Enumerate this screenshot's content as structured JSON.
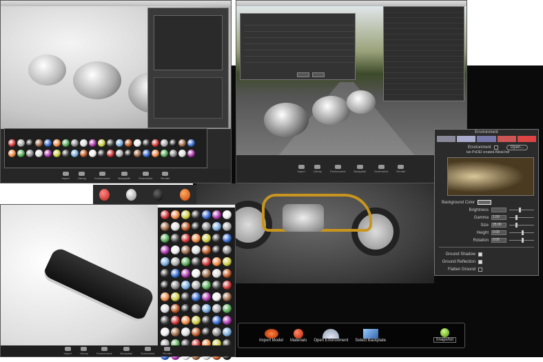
{
  "top_left_window": {
    "toolbar": [
      "Import",
      "Library",
      "Environment",
      "Backplate",
      "Screenshot",
      "Render"
    ]
  },
  "top_right_window": {
    "toolbar": [
      "Import",
      "Library",
      "Environment",
      "Backplate",
      "Screenshot",
      "Render"
    ]
  },
  "environment_panel": {
    "title": "Environment",
    "environment_label": "Environment",
    "open_button": "Open...",
    "file_name": "lan PoDEl created Alleal.hdr",
    "background_color_label": "Background Color",
    "sliders": [
      {
        "label": "Brightness",
        "value": "",
        "fraction": 0.4
      },
      {
        "label": "Gamma",
        "value": "1.00",
        "fraction": 0.25
      },
      {
        "label": "Size",
        "value": "25.00",
        "fraction": 0.25
      },
      {
        "label": "Height",
        "value": "0.00",
        "fraction": 0.5
      },
      {
        "label": "Rotation",
        "value": "0.00",
        "fraction": 0.5
      }
    ],
    "checks": [
      {
        "label": "Ground Shadow",
        "checked": true
      },
      {
        "label": "Ground Reflection",
        "checked": true
      },
      {
        "label": "Flatten Ground",
        "checked": false
      }
    ]
  },
  "main_toolbar": {
    "items": [
      "Import Model",
      "Materials",
      "Open Environment",
      "Select Backplate"
    ],
    "snapshot": "Snapshot"
  },
  "bottom_left_window": {
    "toolbar": [
      "Import",
      "Library",
      "Environment",
      "Backplate",
      "Screenshot",
      "Render"
    ]
  }
}
